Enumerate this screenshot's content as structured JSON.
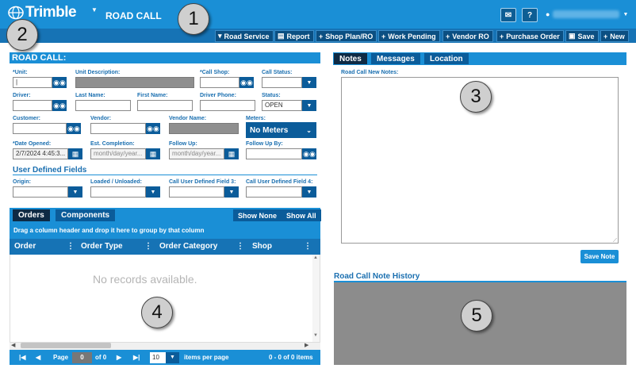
{
  "app": {
    "logo_text": "Trimble",
    "title": "ROAD CALL",
    "user_area_icon": "user-icon",
    "header_icons": [
      "mail-icon",
      "help-icon"
    ]
  },
  "toolbar": {
    "items": [
      {
        "icon": "▾",
        "label": "Road Service"
      },
      {
        "icon": "▤",
        "label": "Report"
      },
      {
        "icon": "+",
        "label": "Shop Plan/RO"
      },
      {
        "icon": "+",
        "label": "Work Pending"
      },
      {
        "icon": "+",
        "label": "Vendor RO"
      },
      {
        "icon": "+",
        "label": "Purchase Order"
      },
      {
        "icon": "▣",
        "label": "Save"
      },
      {
        "icon": "+",
        "label": "New"
      }
    ]
  },
  "road_call": {
    "header": "ROAD CALL:",
    "fields": {
      "unit_label": "*Unit:",
      "unit_desc_label": "Unit Description:",
      "call_shop_label": "*Call Shop:",
      "call_status_label": "Call Status:",
      "driver_label": "Driver:",
      "last_name_label": "Last Name:",
      "first_name_label": "First Name:",
      "driver_phone_label": "Driver Phone:",
      "status_label": "Status:",
      "status_value": "OPEN",
      "customer_label": "Customer:",
      "vendor_label": "Vendor:",
      "vendor_name_label": "Vendor Name:",
      "meters_label": "Meters:",
      "meters_value": "No Meters",
      "date_opened_label": "*Date Opened:",
      "date_opened_value": "2/7/2024 4:45:3...",
      "est_completion_label": "Est. Completion:",
      "est_completion_placeholder": "month/day/year...",
      "follow_up_label": "Follow Up:",
      "follow_up_placeholder": "month/day/year...",
      "follow_up_by_label": "Follow Up By:"
    },
    "udf": {
      "title": "User Defined Fields",
      "origin_label": "Origin:",
      "loaded_label": "Loaded / Unloaded:",
      "udf3_label": "Call User Defined Field 3:",
      "udf4_label": "Call User Defined Field 4:"
    }
  },
  "orders": {
    "tabs": [
      "Orders",
      "Components"
    ],
    "show_none": "Show None",
    "show_all": "Show All",
    "group_hint": "Drag a column header and drop it here to group by that column",
    "columns": [
      "Order",
      "Order Type",
      "Order Category",
      "Shop"
    ],
    "empty_text": "No records available.",
    "pager": {
      "page_label": "Page",
      "page_value": "0",
      "of_label": "of 0",
      "page_size": "10",
      "items_per_page": "items per page",
      "summary": "0 - 0 of 0 items"
    }
  },
  "notes": {
    "tabs": [
      "Notes",
      "Messages",
      "Location"
    ],
    "new_notes_label": "Road Call New Notes:",
    "save_note": "Save Note",
    "history_title": "Road Call Note History"
  },
  "callouts": [
    "1",
    "2",
    "3",
    "4",
    "5"
  ]
}
